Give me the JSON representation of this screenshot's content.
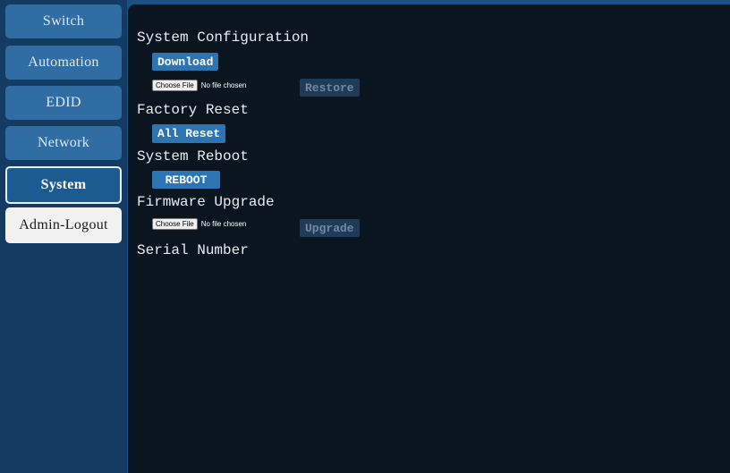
{
  "sidebar": {
    "items": [
      {
        "label": "Switch"
      },
      {
        "label": "Automation"
      },
      {
        "label": "EDID"
      },
      {
        "label": "Network"
      },
      {
        "label": "System"
      },
      {
        "label": "Admin-Logout"
      }
    ]
  },
  "main": {
    "system_configuration": {
      "title": "System Configuration",
      "download_label": "Download",
      "file_button_label": "Choose File",
      "file_status": "No file chosen",
      "restore_label": "Restore"
    },
    "factory_reset": {
      "title": "Factory Reset",
      "all_reset_label": "All Reset"
    },
    "system_reboot": {
      "title": "System Reboot",
      "reboot_label": "REBOOT"
    },
    "firmware_upgrade": {
      "title": "Firmware Upgrade",
      "file_button_label": "Choose File",
      "file_status": "No file chosen",
      "upgrade_label": "Upgrade"
    },
    "serial_number": {
      "title": "Serial Number"
    }
  },
  "colors": {
    "page_background": "#1d4f80",
    "sidebar_background": "#143c62",
    "content_background": "#0b1520",
    "nav_button": "#2f6da3",
    "nav_button_active": "#1b5b92",
    "action_button": "#2d74b3",
    "action_button_disabled": "#1f3b57"
  }
}
